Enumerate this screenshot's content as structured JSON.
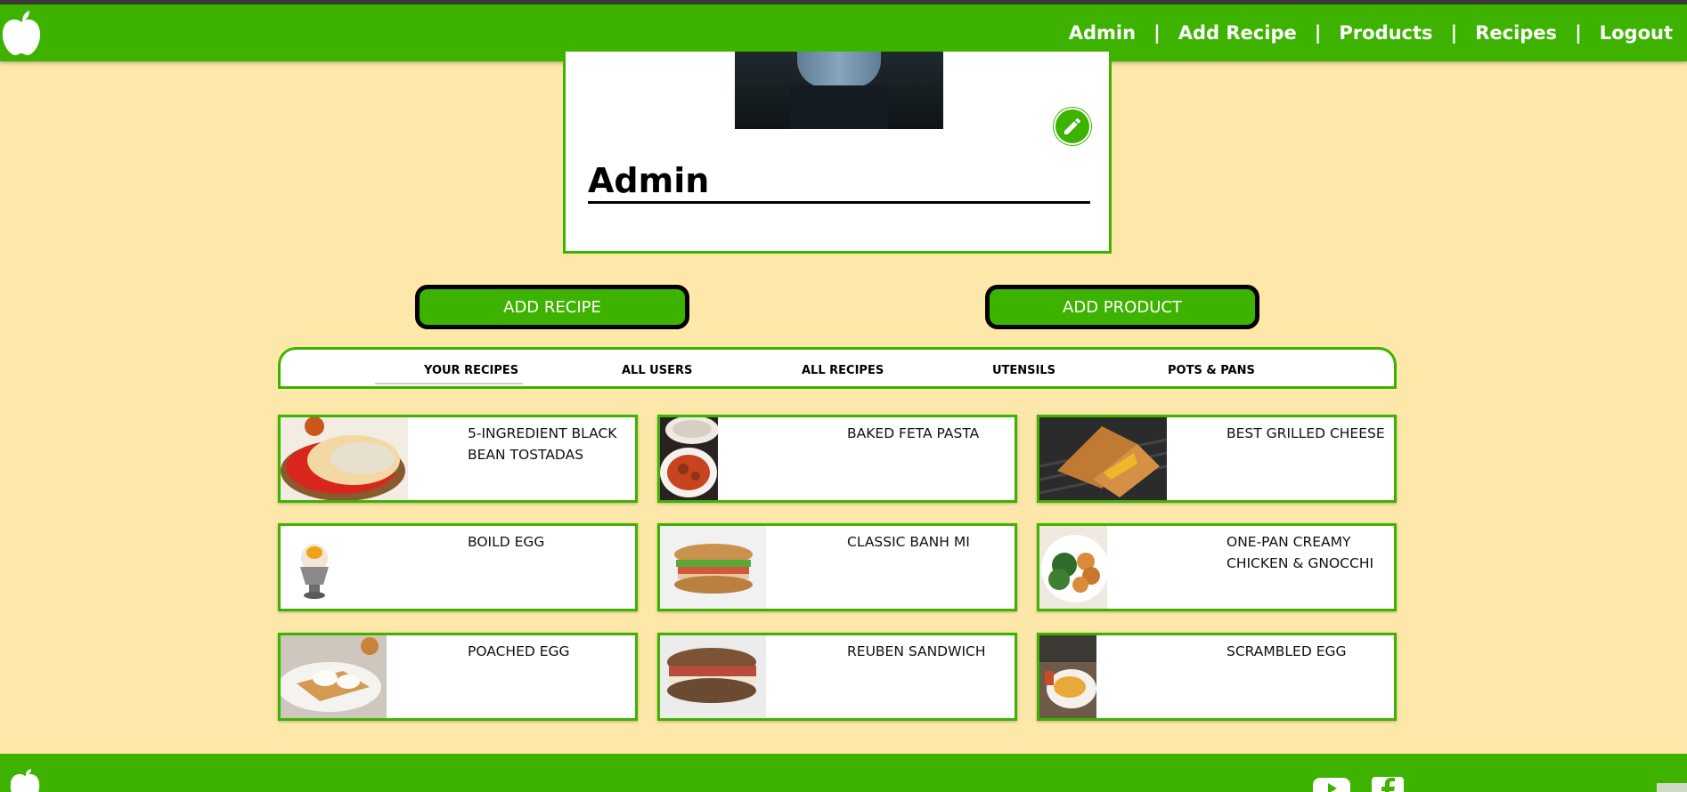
{
  "nav": {
    "links": [
      "Admin",
      "Add Recipe",
      "Products",
      "Recipes",
      "Logout"
    ],
    "separator": "|"
  },
  "profile": {
    "name": "Admin"
  },
  "actions": {
    "add_recipe": "ADD RECIPE",
    "add_product": "ADD PRODUCT"
  },
  "tabs": [
    "YOUR RECIPES",
    "ALL USERS",
    "ALL RECIPES",
    "UTENSILS",
    "POTS & PANS"
  ],
  "recipes": [
    "5-INGREDIENT BLACK BEAN TOSTADAS",
    "BAKED FETA PASTA",
    "BEST GRILLED CHEESE",
    "BOILD EGG",
    "CLASSIC BANH MI",
    "ONE-PAN CREAMY CHICKEN & GNOCCHI",
    "POACHED EGG",
    "REUBEN SANDWICH",
    "SCRAMBLED EGG"
  ],
  "colors": {
    "brand_green": "#3db300",
    "background": "#fde7a9"
  },
  "icons": [
    "apple-logo-icon",
    "pencil-icon",
    "youtube-icon",
    "facebook-icon"
  ]
}
